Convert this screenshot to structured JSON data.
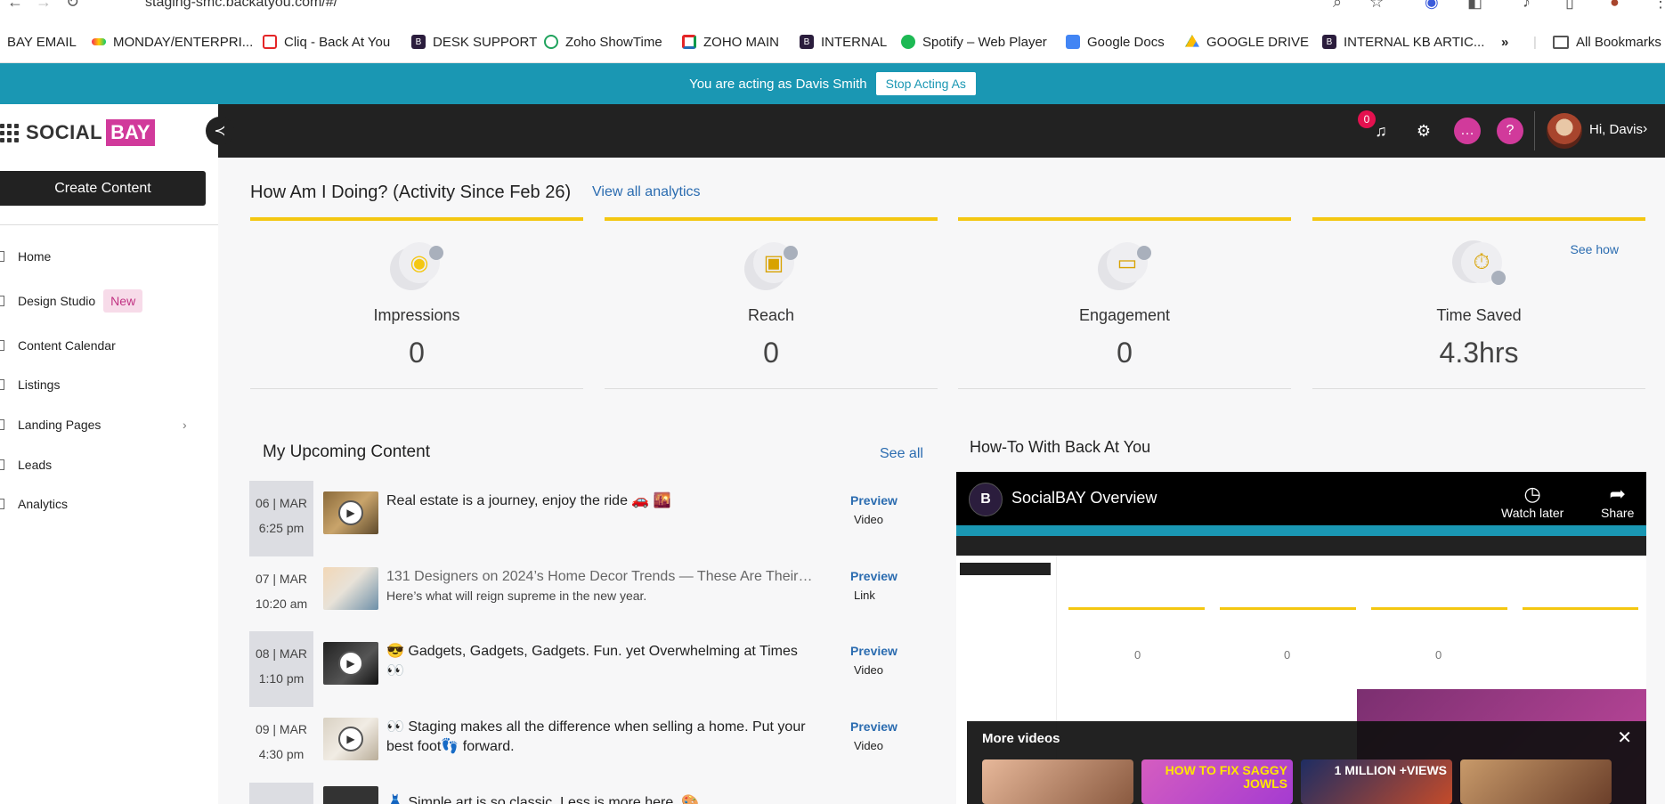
{
  "browser": {
    "url": "staging-smc.backatyou.com/#/",
    "bookmarks": [
      {
        "label": "BAY EMAIL",
        "icon": "none"
      },
      {
        "label": "MONDAY/ENTERPRI...",
        "icon": "monday-icon"
      },
      {
        "label": "Cliq - Back At You",
        "icon": "cliq-icon"
      },
      {
        "label": "DESK SUPPORT",
        "icon": "bay-icon"
      },
      {
        "label": "Zoho ShowTime",
        "icon": "showtime-icon"
      },
      {
        "label": "ZOHO MAIN",
        "icon": "zoho-icon"
      },
      {
        "label": "INTERNAL",
        "icon": "bay-icon"
      },
      {
        "label": "Spotify – Web Player",
        "icon": "spotify-icon"
      },
      {
        "label": "Google Docs",
        "icon": "docs-icon"
      },
      {
        "label": "GOOGLE  DRIVE",
        "icon": "drive-icon"
      },
      {
        "label": "INTERNAL KB ARTIC...",
        "icon": "bay-icon"
      }
    ],
    "more_label": "»",
    "all_bookmarks": "All Bookmarks"
  },
  "acting": {
    "text": "You are acting as Davis Smith",
    "button": "Stop Acting As"
  },
  "sidebar": {
    "logo_a": "SOCIAL",
    "logo_b": "BAY",
    "create_label": "Create Content",
    "items": [
      {
        "label": "Home"
      },
      {
        "label": "Design Studio",
        "badge": "New"
      },
      {
        "label": "Content Calendar"
      },
      {
        "label": "Listings"
      },
      {
        "label": "Landing Pages"
      },
      {
        "label": "Leads"
      },
      {
        "label": "Analytics"
      }
    ]
  },
  "topbar": {
    "notification_count": "0",
    "greeting": "Hi, Davis"
  },
  "analytics": {
    "heading": "How Am I Doing? (Activity Since Feb 26)",
    "view_all": "View all analytics",
    "see_how": "See how",
    "cards": [
      {
        "label": "Impressions",
        "value": "0",
        "icon": "eye-icon"
      },
      {
        "label": "Reach",
        "value": "0",
        "icon": "contact-card-icon"
      },
      {
        "label": "Engagement",
        "value": "0",
        "icon": "chat-bubble-icon"
      },
      {
        "label": "Time Saved",
        "value": "4.3hrs",
        "icon": "stopwatch-icon"
      }
    ]
  },
  "upcoming": {
    "heading": "My Upcoming Content",
    "see_all": "See all",
    "preview_label": "Preview",
    "items": [
      {
        "day": "06 | MAR",
        "time": "6:25 pm",
        "title": "Real estate is a journey, enjoy the ride 🚗 🌇",
        "subtitle": "",
        "kind": "Video"
      },
      {
        "day": "07 | MAR",
        "time": "10:20 am",
        "title": "131 Designers on 2024’s Home Decor Trends — These Are Their…",
        "subtitle": "Here’s what will reign supreme in the new year.",
        "kind": "Link"
      },
      {
        "day": "08 | MAR",
        "time": "1:10 pm",
        "title": "😎 Gadgets, Gadgets, Gadgets. Fun. yet Overwhelming at Times 👀",
        "subtitle": "",
        "kind": "Video"
      },
      {
        "day": "09 | MAR",
        "time": "4:30 pm",
        "title": "👀 Staging makes all the difference when selling a home. Put your best foot👣 forward.",
        "subtitle": "",
        "kind": "Video"
      },
      {
        "day": "",
        "time": "",
        "title": "👗 Simple art is so classic. Less is more here. 🎨",
        "subtitle": "",
        "kind": ""
      }
    ]
  },
  "howto": {
    "heading": "How-To With Back At You",
    "video_title": "SocialBAY Overview",
    "watch_later": "Watch later",
    "share": "Share",
    "more_videos": "More videos",
    "thumb_captions": [
      "",
      "HOW TO FIX SAGGY JOWLS",
      "1 MILLION +VIEWS",
      ""
    ]
  }
}
